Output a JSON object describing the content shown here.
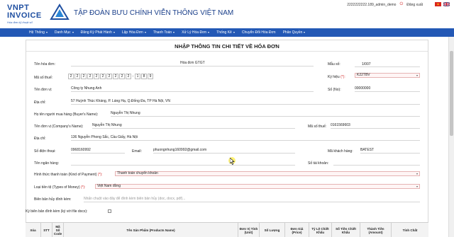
{
  "header": {
    "logo_line1": "VNPT",
    "logo_line2": "INVOICE",
    "logo_tagline": "Hóa đơn kỹ thuật số",
    "corp_title": "TẬP  ĐOÀN BƯU CHÍNH VIỄN THÔNG VIỆT NAM",
    "username": "2222222222.189_admin_demo",
    "logout_label": "Đăng xuất"
  },
  "nav": {
    "items": [
      {
        "label": "Hệ Thống",
        "dropdown": true
      },
      {
        "label": "Danh Mục",
        "dropdown": true
      },
      {
        "label": "Đăng Ký Phát Hành",
        "dropdown": true
      },
      {
        "label": "Lập Hóa Đơn",
        "dropdown": true
      },
      {
        "label": "Thanh Toán",
        "dropdown": true
      },
      {
        "label": "Xử Lý Hóa Đơn",
        "dropdown": true
      },
      {
        "label": "Thống Kê",
        "dropdown": true
      },
      {
        "label": "Chuyển Đổi Hóa Đơn",
        "dropdown": false
      },
      {
        "label": "Phân Quyền",
        "dropdown": true
      }
    ]
  },
  "form": {
    "title": "NHẬP THÔNG TIN CHI TIẾT VỀ HÓA ĐƠN",
    "invoice_name_label": "Tên hóa đơn:",
    "invoice_name_value": "Hóa đơn GTGT",
    "template_label": "Mẫu số:",
    "template_value": "1/007",
    "tax_code_label": "Mã số thuế:",
    "tax_code_chars": [
      "2",
      "2",
      "2",
      "2",
      "2",
      "2",
      "2",
      "2",
      "2",
      "2",
      "-",
      "1",
      "8",
      "9"
    ],
    "symbol_label": "Ký hiệu",
    "symbol_req": "(*):",
    "symbol_value": "K22TBV",
    "unit_name_label": "Tên đơn vị:",
    "unit_name_value": "Công ty Nhung Anh",
    "number_label": "Số (No):",
    "number_value": "00000000",
    "address_label": "Địa chỉ:",
    "address_value": "57 Huỳnh Thúc Kháng, P. Láng Hạ, Q.Đống Đa, TP Hà Nội, VN",
    "buyer_label": "Họ tên người mua hàng (Buyer's Name):",
    "buyer_value": "Nguyễn Thị Nhung",
    "company_label": "Tên đơn vị (Company's Name):",
    "company_value": "Nguyễn Thị Nhung",
    "buyer_tax_label": "Mã số thuế:",
    "buyer_tax_value": "0161569603",
    "buyer_address_label": "Địa chỉ:",
    "buyer_address_value": "136 Nguyễn Phong Sắc, Cầu Giấy, Hà Nội",
    "phone_label": "Số điện thoại:",
    "phone_value": "0968160992",
    "email_label": "Email:",
    "email_value": "phuongnhung160992@gmail.com",
    "customer_code_label": "Mã khách hàng:",
    "customer_code_value": "BATEST",
    "bank_name_label": "Tên ngân hàng:",
    "bank_account_label": "Số tài khoản:",
    "payment_label": "Hình thức thanh toán (Kind of Payment)",
    "payment_req": "(*):",
    "payment_value": "Thanh toán chuyển khoản",
    "currency_label": "Loại tiền tệ (Types of Money)",
    "currency_req": "(*):",
    "currency_value": "Việt Nam đồng",
    "cancel_record_label": "Biên bản hủy đính kèm:",
    "cancel_record_placeholder": "Nhấn chuột vào đây để đính kèm biên bản hủy (doc, docx, pdf)...",
    "sign_label": "Ký biên bản đính kèm (ký với file docx):"
  },
  "table": {
    "headers": [
      "Xóa",
      "STT",
      "Mã Số Code",
      "Tên Sản Phẩm (Products Name)",
      "Đơn Vị Tính (Unit)",
      "Số Lượng",
      "Đơn Giá (Price)",
      "Tỷ Lệ Chiết Khấu",
      "Số Tiền Chiết Khấu",
      "Thành Tiền (Amount)",
      "Tính Chất"
    ]
  }
}
